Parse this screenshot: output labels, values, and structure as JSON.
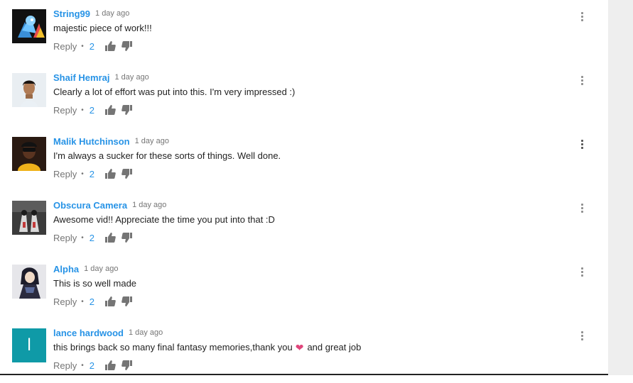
{
  "comments": [
    {
      "author": "String99",
      "time": "1 day ago",
      "text": "majestic piece of work!!!",
      "reply_label": "Reply",
      "likes": "2",
      "avatar": "pony-avatar"
    },
    {
      "author": "Shaif Hemraj",
      "time": "1 day ago",
      "text": "Clearly a lot of effort was put into this. I'm very impressed :)",
      "reply_label": "Reply",
      "likes": "2",
      "avatar": "person-avatar"
    },
    {
      "author": "Malik Hutchinson",
      "time": "1 day ago",
      "text": "I'm always a sucker for these sorts of things. Well done.",
      "reply_label": "Reply",
      "likes": "2",
      "avatar": "person-avatar"
    },
    {
      "author": "Obscura Camera",
      "time": "1 day ago",
      "text": "Awesome vid!! Appreciate the time you put into that :D",
      "reply_label": "Reply",
      "likes": "2",
      "avatar": "photo-avatar"
    },
    {
      "author": "Alpha",
      "time": "1 day ago",
      "text": "This is so well made",
      "reply_label": "Reply",
      "likes": "2",
      "avatar": "anime-avatar"
    },
    {
      "author": "lance hardwood",
      "time": "1 day ago",
      "text": "this brings back so many final fantasy memories,thank you",
      "text_after": "and great job",
      "emoji": "heart",
      "reply_label": "Reply",
      "likes": "2",
      "avatar_letter": "l",
      "avatar_color": "#0f9aa7"
    }
  ],
  "colors": {
    "author": "#2793e6",
    "likes": "#2793e6",
    "heart": "#e0457b"
  }
}
